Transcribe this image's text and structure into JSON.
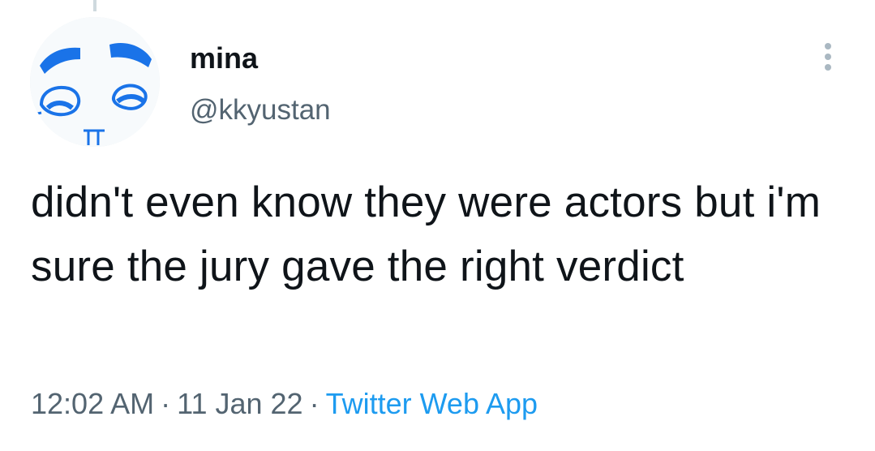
{
  "user": {
    "display_name": "mina",
    "handle": "@kkyustan",
    "avatar_icon": "doodle-face-avatar"
  },
  "tweet": {
    "text": "didn't even know they were actors but i'm sure the jury gave the right verdict",
    "time": "12:02 AM",
    "date": "11 Jan 22",
    "separator": "·",
    "source": "Twitter Web App"
  },
  "actions": {
    "more_icon": "more-vertical-icon"
  },
  "colors": {
    "text_primary": "#0f1419",
    "text_secondary": "#536471",
    "link": "#1d9bf0",
    "avatar_ink": "#1a73e8"
  }
}
